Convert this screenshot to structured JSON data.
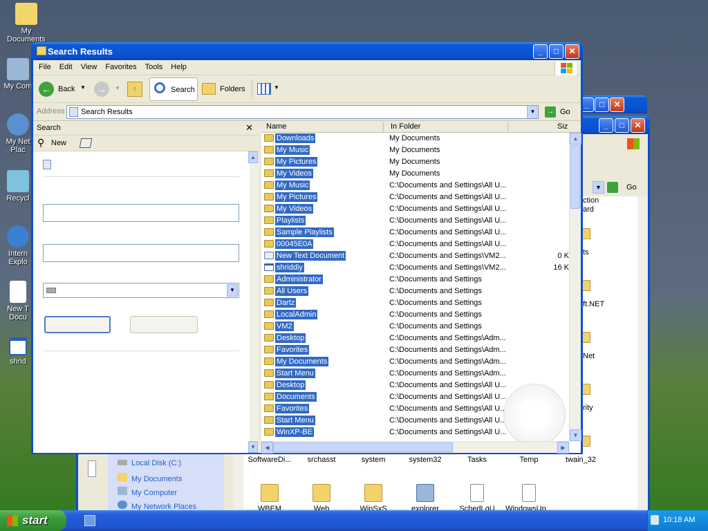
{
  "desktop": {
    "icons": [
      "My Documents",
      "My Com",
      "My Net Plac",
      "Recycl",
      "Intern Explo",
      "New T Docu",
      "shrid"
    ]
  },
  "back_windows": {
    "address_go": "Go",
    "fragments": [
      "ction",
      "ard",
      "ts",
      "ft.NET",
      "Net",
      "rity"
    ],
    "side_links": [
      "Local Disk (C:)",
      "My Documents",
      "My Computer",
      "My Network Places"
    ],
    "row1": [
      "SoftwareDi...",
      "srchasst",
      "system",
      "system32",
      "Tasks",
      "Temp",
      "twain_32"
    ],
    "row2": [
      "WBEM",
      "Web",
      "WinSxS",
      "explorer",
      "SchedLgU",
      "WindowsUp..."
    ]
  },
  "window": {
    "title": "Search Results",
    "menu": [
      "File",
      "Edit",
      "View",
      "Favorites",
      "Tools",
      "Help"
    ],
    "toolbar": {
      "back": "Back",
      "search": "Search",
      "folders": "Folders"
    },
    "address": {
      "label": "Address",
      "value": "Search Results",
      "go": "Go"
    },
    "search_pane": {
      "title": "Search",
      "new_label": "New"
    },
    "columns": {
      "name": "Name",
      "in_folder": "In Folder",
      "size": "Siz"
    },
    "rows": [
      {
        "name": "Downloads",
        "folder": "My Documents",
        "size": "",
        "icon": "folder"
      },
      {
        "name": "My Music",
        "folder": "My Documents",
        "size": "",
        "icon": "folder"
      },
      {
        "name": "My Pictures",
        "folder": "My Documents",
        "size": "",
        "icon": "folder"
      },
      {
        "name": "My Videos",
        "folder": "My Documents",
        "size": "",
        "icon": "folder"
      },
      {
        "name": "My Music",
        "folder": "C:\\Documents and Settings\\All U...",
        "size": "",
        "icon": "folder"
      },
      {
        "name": "My Pictures",
        "folder": "C:\\Documents and Settings\\All U...",
        "size": "",
        "icon": "folder"
      },
      {
        "name": "My Videos",
        "folder": "C:\\Documents and Settings\\All U...",
        "size": "",
        "icon": "folder"
      },
      {
        "name": "Playlists",
        "folder": "C:\\Documents and Settings\\All U...",
        "size": "",
        "icon": "folder"
      },
      {
        "name": "Sample Playlists",
        "folder": "C:\\Documents and Settings\\All U...",
        "size": "",
        "icon": "folder"
      },
      {
        "name": "00045E0A",
        "folder": "C:\\Documents and Settings\\All U...",
        "size": "",
        "icon": "folder"
      },
      {
        "name": "New Text Document",
        "folder": "C:\\Documents and Settings\\VM2...",
        "size": "0 K",
        "icon": "doc"
      },
      {
        "name": "shriddiy",
        "folder": "C:\\Documents and Settings\\VM2...",
        "size": "16 K",
        "icon": "win"
      },
      {
        "name": "Administrator",
        "folder": "C:\\Documents and Settings",
        "size": "",
        "icon": "folder"
      },
      {
        "name": "All Users",
        "folder": "C:\\Documents and Settings",
        "size": "",
        "icon": "folder"
      },
      {
        "name": "Dartz",
        "folder": "C:\\Documents and Settings",
        "size": "",
        "icon": "folder"
      },
      {
        "name": "LocalAdmin",
        "folder": "C:\\Documents and Settings",
        "size": "",
        "icon": "folder"
      },
      {
        "name": "VM2",
        "folder": "C:\\Documents and Settings",
        "size": "",
        "icon": "folder"
      },
      {
        "name": "Desktop",
        "folder": "C:\\Documents and Settings\\Adm...",
        "size": "",
        "icon": "folder"
      },
      {
        "name": "Favorites",
        "folder": "C:\\Documents and Settings\\Adm...",
        "size": "",
        "icon": "folder"
      },
      {
        "name": "My Documents",
        "folder": "C:\\Documents and Settings\\Adm...",
        "size": "",
        "icon": "folder"
      },
      {
        "name": "Start Menu",
        "folder": "C:\\Documents and Settings\\Adm...",
        "size": "",
        "icon": "folder"
      },
      {
        "name": "Desktop",
        "folder": "C:\\Documents and Settings\\All U...",
        "size": "",
        "icon": "folder"
      },
      {
        "name": "Documents",
        "folder": "C:\\Documents and Settings\\All U...",
        "size": "",
        "icon": "folder"
      },
      {
        "name": "Favorites",
        "folder": "C:\\Documents and Settings\\All U...",
        "size": "",
        "icon": "folder"
      },
      {
        "name": "Start Menu",
        "folder": "C:\\Documents and Settings\\All U...",
        "size": "",
        "icon": "folder"
      },
      {
        "name": "WinXP-BE",
        "folder": "C:\\Documents and Settings\\All U...",
        "size": "",
        "icon": "folder"
      }
    ]
  },
  "taskbar": {
    "start": "start",
    "clock": "10:18 AM"
  }
}
